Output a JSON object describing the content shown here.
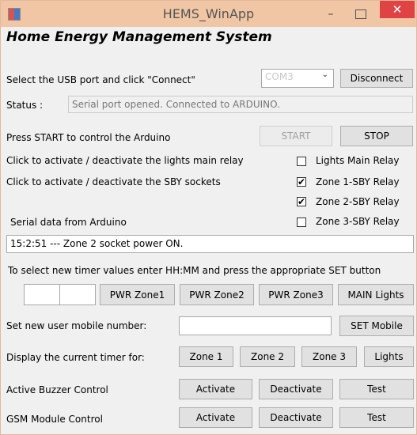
{
  "window": {
    "title": "HEMS_WinApp",
    "minimize_glyph": "–",
    "close_glyph": "✕"
  },
  "header": "Home Energy  Management System",
  "usb": {
    "label": "Select the USB port and click \"Connect\"",
    "port_value": "COM3",
    "disconnect_label": "Disconnect"
  },
  "status": {
    "label": "Status :",
    "value": "Serial port opened. Connected to ARDUINO."
  },
  "control": {
    "label": "Press START to control the Arduino",
    "start_label": "START",
    "stop_label": "STOP"
  },
  "relays": {
    "lights_text": "Click to activate / deactivate the lights main relay",
    "sby_text": "Click to activate / deactivate the SBY sockets",
    "items": [
      {
        "label": "Lights  Main Relay",
        "checked": false
      },
      {
        "label": "Zone 1-SBY Relay",
        "checked": true
      },
      {
        "label": "Zone 2-SBY Relay",
        "checked": true
      },
      {
        "label": "Zone 3-SBY Relay",
        "checked": false
      }
    ],
    "check_glyph": "✔"
  },
  "serial": {
    "label": "Serial data from Arduino",
    "value": "15:2:51 --- Zone 2 socket power ON."
  },
  "timer": {
    "instruction": "To select new timer values enter HH:MM and press the appropriate SET button",
    "hh_value": "",
    "mm_value": "",
    "buttons": [
      "PWR Zone1",
      "PWR Zone2",
      "PWR Zone3",
      "MAIN Lights"
    ]
  },
  "mobile": {
    "label": "Set new user mobile number:",
    "value": "",
    "set_label": "SET Mobile"
  },
  "display_timer": {
    "label": "Display the current timer for:",
    "buttons": [
      "Zone 1",
      "Zone 2",
      "Zone 3",
      "Lights"
    ]
  },
  "buzzer": {
    "label": "Active Buzzer Control",
    "activate": "Activate",
    "deactivate": "Deactivate",
    "test": "Test"
  },
  "gsm": {
    "label": "GSM Module Control",
    "activate": "Activate",
    "deactivate": "Deactivate",
    "test": "Test"
  }
}
